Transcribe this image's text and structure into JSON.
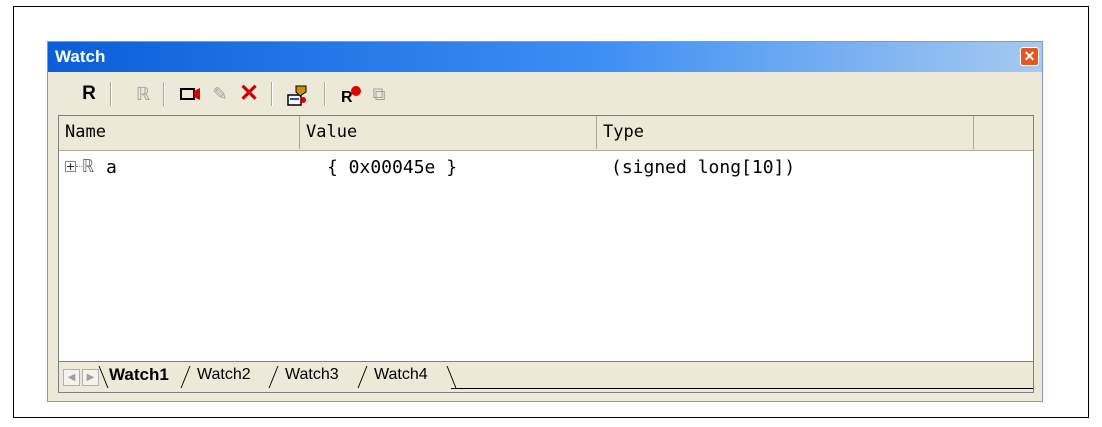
{
  "window": {
    "title": "Watch",
    "close_glyph": "✕"
  },
  "toolbar": {
    "items": [
      {
        "name": "register-r-icon",
        "glyph": "R",
        "enabled": true
      },
      {
        "name": "register-r-disabled-icon",
        "glyph": "ℝ",
        "enabled": false
      },
      {
        "name": "camera-icon",
        "glyph": "▭",
        "enabled": true
      },
      {
        "name": "pencil-icon",
        "glyph": "✎",
        "enabled": false
      },
      {
        "name": "delete-x-icon",
        "glyph": "✕",
        "enabled": true
      },
      {
        "name": "settings-icon",
        "glyph": "⚙",
        "enabled": true
      },
      {
        "name": "register-breakpoint-icon",
        "glyph": "R●",
        "enabled": true
      },
      {
        "name": "register-copy-icon",
        "glyph": "⧉",
        "enabled": false
      }
    ]
  },
  "columns": {
    "name": "Name",
    "value": "Value",
    "type": "Type"
  },
  "rows": [
    {
      "expander": "+",
      "icon": "ℝ",
      "name": "a",
      "value": "{ 0x00045e }",
      "type": "(signed long[10])"
    }
  ],
  "tabs": [
    {
      "label": "Watch1",
      "active": true
    },
    {
      "label": "Watch2",
      "active": false
    },
    {
      "label": "Watch3",
      "active": false
    },
    {
      "label": "Watch4",
      "active": false
    }
  ],
  "tab_nav": {
    "prev": "◀",
    "next": "▶"
  },
  "colors": {
    "titlebar": "#0a5fd8",
    "close": "#e2581f",
    "delete": "#d40000",
    "breakpoint": "#e00000"
  }
}
